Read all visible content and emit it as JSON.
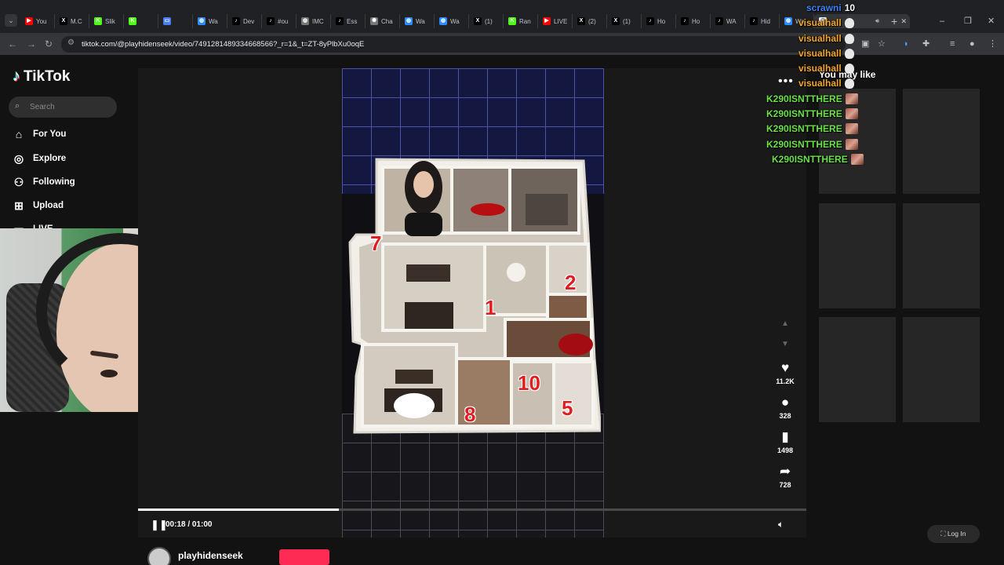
{
  "browser": {
    "tabs": [
      {
        "label": "You",
        "icon": "youtube-icon",
        "color": "#ff0000"
      },
      {
        "label": "M.C",
        "icon": "x-icon",
        "color": "#000000"
      },
      {
        "label": "Slik",
        "icon": "kick-icon",
        "color": "#53fc18"
      },
      {
        "label": "",
        "icon": "kick-icon",
        "color": "#53fc18"
      },
      {
        "label": "",
        "icon": "window-icon",
        "color": "#4a7ef0"
      },
      {
        "label": "Wa",
        "icon": "globe-icon",
        "color": "#2d8cff"
      },
      {
        "label": "Dev",
        "icon": "tiktok-icon",
        "color": "#000000"
      },
      {
        "label": "#ou",
        "icon": "tiktok-icon",
        "color": "#000000"
      },
      {
        "label": "IMC",
        "icon": "globe-icon",
        "color": "#777777"
      },
      {
        "label": "Ess",
        "icon": "tiktok-icon",
        "color": "#000000"
      },
      {
        "label": "Cha",
        "icon": "openai-icon",
        "color": "#777777"
      },
      {
        "label": "Wa",
        "icon": "globe-icon",
        "color": "#2d8cff"
      },
      {
        "label": "Wa",
        "icon": "globe-icon",
        "color": "#2d8cff"
      },
      {
        "label": "(1)",
        "icon": "x-icon",
        "color": "#000000"
      },
      {
        "label": "Ran",
        "icon": "kick-icon",
        "color": "#53fc18"
      },
      {
        "label": "LIVE",
        "icon": "youtube-icon",
        "color": "#ff0000"
      },
      {
        "label": "(2)",
        "icon": "x-icon",
        "color": "#000000"
      },
      {
        "label": "(1)",
        "icon": "x-icon",
        "color": "#000000"
      },
      {
        "label": "Ho",
        "icon": "tiktok-icon",
        "color": "#000000"
      },
      {
        "label": "Ho",
        "icon": "tiktok-icon",
        "color": "#000000"
      },
      {
        "label": "WA",
        "icon": "tiktok-icon",
        "color": "#000000"
      },
      {
        "label": "Hid",
        "icon": "tiktok-icon",
        "color": "#000000"
      },
      {
        "label": "Wa",
        "icon": "globe-icon",
        "color": "#2d8cff"
      }
    ],
    "active_tab": {
      "label": "",
      "icon": "google-icon"
    },
    "new_tab": "+",
    "window_controls": {
      "minimize": "–",
      "maximize": "❐",
      "close": "✕"
    },
    "url": "tiktok.com/@playhidenseek/video/7491281489334668566?_r=1&_t=ZT-8yPlbXu0oqE"
  },
  "tiktok": {
    "brand": "TikTok",
    "search_placeholder": "Search",
    "nav": [
      {
        "label": "For You",
        "icon": "home-icon"
      },
      {
        "label": "Explore",
        "icon": "compass-icon"
      },
      {
        "label": "Following",
        "icon": "following-icon"
      },
      {
        "label": "Upload",
        "icon": "upload-icon"
      },
      {
        "label": "LIVE",
        "icon": "live-icon"
      }
    ],
    "video": {
      "room_numbers": [
        "7",
        "2",
        "1",
        "10",
        "8",
        "5"
      ],
      "elapsed": "00:18",
      "duration": "01:00",
      "timecode": "00:18 / 01:00",
      "progress_fraction": 0.3
    },
    "actions": {
      "likes": "11.2K",
      "comments": "328",
      "saves": "1498",
      "shares": "728"
    },
    "author": {
      "username": "playhidenseek"
    },
    "recommendations_title": "You may like",
    "login": "Log In"
  },
  "chat": [
    {
      "user": "scrawni",
      "color": "#3b82f6",
      "message": "10"
    },
    {
      "user": "visualhall",
      "color": "#f5a623",
      "message": ""
    },
    {
      "user": "visualhall",
      "color": "#f5a623",
      "message": ""
    },
    {
      "user": "visualhall",
      "color": "#f5a623",
      "message": ""
    },
    {
      "user": "visualhall",
      "color": "#f5a623",
      "message": ""
    },
    {
      "user": "visualhall",
      "color": "#f5a623",
      "message": ""
    },
    {
      "user": "K290ISNTTHERE",
      "color": "#6be24a",
      "message": ""
    },
    {
      "user": "K290ISNTTHERE",
      "color": "#6be24a",
      "message": ""
    },
    {
      "user": "K290ISNTTHERE",
      "color": "#6be24a",
      "message": ""
    },
    {
      "user": "K290ISNTTHERE",
      "color": "#6be24a",
      "message": ""
    },
    {
      "user": "K290ISNTTHERE",
      "color": "#6be24a",
      "message": ""
    }
  ]
}
